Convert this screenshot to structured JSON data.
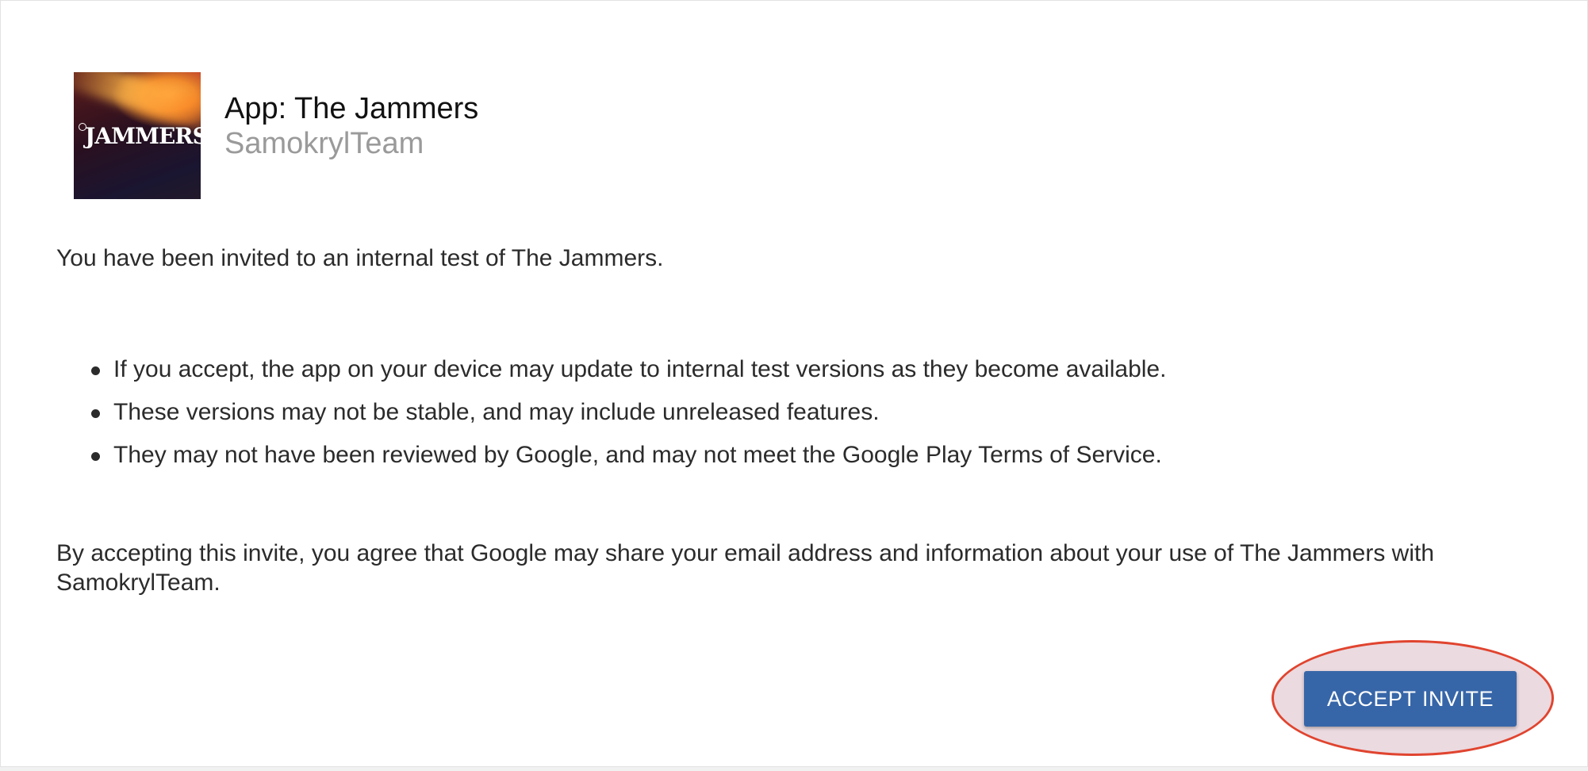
{
  "app": {
    "icon_name": "the-jammers-app-icon",
    "icon_logo_text": "JAMMERS",
    "title": "App: The Jammers",
    "developer": "SamokrylTeam"
  },
  "intro_text": "You have been invited to an internal test of The Jammers.",
  "bullets": [
    "If you accept, the app on your device may update to internal test versions as they become available.",
    "These versions may not be stable, and may include unreleased features.",
    "They may not have been reviewed by Google, and may not meet the Google Play Terms of Service."
  ],
  "agreement_text": "By accepting this invite, you agree that Google may share your email address and information about your use of The Jammers with SamokrylTeam.",
  "actions": {
    "accept_label": "ACCEPT INVITE"
  },
  "colors": {
    "accent_button": "#3766a8",
    "highlight_outline": "#e0442f",
    "developer_text": "#9a9a9a"
  }
}
